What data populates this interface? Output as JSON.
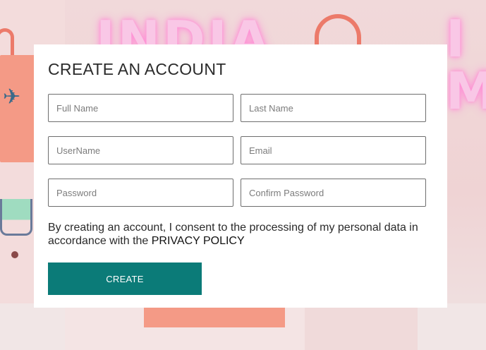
{
  "form": {
    "title": "CREATE AN ACCOUNT",
    "fields": {
      "full_name": {
        "placeholder": "Full Name",
        "value": ""
      },
      "last_name": {
        "placeholder": "Last Name",
        "value": ""
      },
      "username": {
        "placeholder": "UserName",
        "value": ""
      },
      "email": {
        "placeholder": "Email",
        "value": ""
      },
      "password": {
        "placeholder": "Password",
        "value": ""
      },
      "confirm_password": {
        "placeholder": "Confirm Password",
        "value": ""
      }
    },
    "consent_text": "By creating an account, I consent to the processing of my personal data in accordance with the ",
    "privacy_link_label": "PRIVACY POLICY",
    "submit_label": "CREATE"
  },
  "background": {
    "neon_left": "INDIA",
    "neon_right": "INM",
    "accent_color": "#0b7b78",
    "bag_color": "#f49a86"
  }
}
